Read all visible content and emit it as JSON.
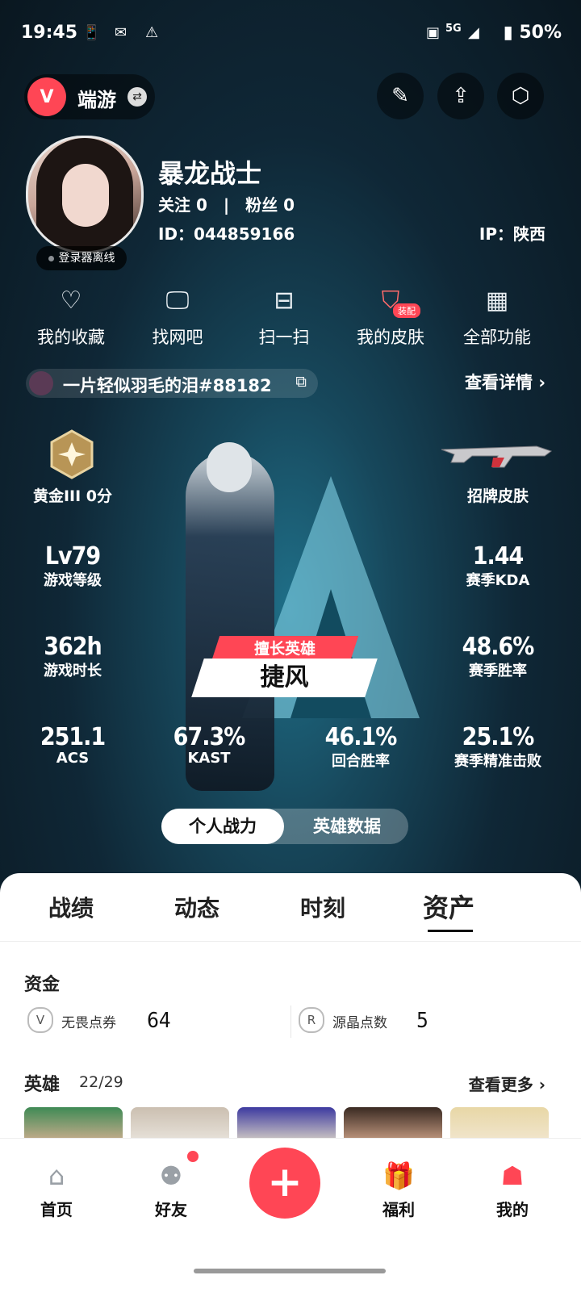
{
  "status_bar": {
    "time": "19:45",
    "network": "5G",
    "battery": "50%"
  },
  "header": {
    "game_logo": "V",
    "game_name": "端游",
    "icons": [
      "edit-card-icon",
      "share-icon",
      "settings-icon"
    ]
  },
  "profile": {
    "username": "暴龙战士",
    "follow_text": "关注 0　|　粉丝 0",
    "id_text": "ID：044859166",
    "ip_text": "IP：陕西",
    "login_status": "登录器离线"
  },
  "quick_actions": [
    {
      "label": "我的收藏",
      "icon": "heart-icon"
    },
    {
      "label": "找网吧",
      "icon": "monitor-icon"
    },
    {
      "label": "扫一扫",
      "icon": "scan-icon"
    },
    {
      "label": "我的皮肤",
      "icon": "skin-icon",
      "badge": "装配"
    },
    {
      "label": "全部功能",
      "icon": "grid-icon"
    }
  ],
  "riot_id": "一片轻似羽毛的泪#88182",
  "view_details": "查看详情",
  "rank": {
    "label": "黄金III 0分"
  },
  "skin": {
    "label": "招牌皮肤"
  },
  "stats": {
    "level": {
      "value": "Lv79",
      "label": "游戏等级"
    },
    "kda": {
      "value": "1.44",
      "label": "赛季KDA"
    },
    "hours": {
      "value": "362h",
      "label": "游戏时长"
    },
    "winrate": {
      "value": "48.6%",
      "label": "赛季胜率"
    },
    "acs": {
      "value": "251.1",
      "label": "ACS"
    },
    "kast": {
      "value": "67.3%",
      "label": "KAST"
    },
    "round_win": {
      "value": "46.1%",
      "label": "回合胜率"
    },
    "precise": {
      "value": "25.1%",
      "label": "赛季精准击败"
    }
  },
  "hero": {
    "tag": "擅长英雄",
    "name": "捷风"
  },
  "segment": {
    "left": "个人战力",
    "right": "英雄数据"
  },
  "tabs": [
    "战绩",
    "动态",
    "时刻",
    "资产"
  ],
  "funds": {
    "title": "资金",
    "items": [
      {
        "label": "无畏点券",
        "value": "64"
      },
      {
        "label": "源晶点数",
        "value": "5"
      }
    ]
  },
  "heroes_section": {
    "title": "英雄",
    "count": "22",
    "total": "29",
    "more": "查看更多"
  },
  "nav": [
    {
      "label": "首页"
    },
    {
      "label": "好友"
    },
    {
      "label": "福利"
    },
    {
      "label": "我的"
    }
  ],
  "colors": {
    "accent": "#ff4655"
  }
}
